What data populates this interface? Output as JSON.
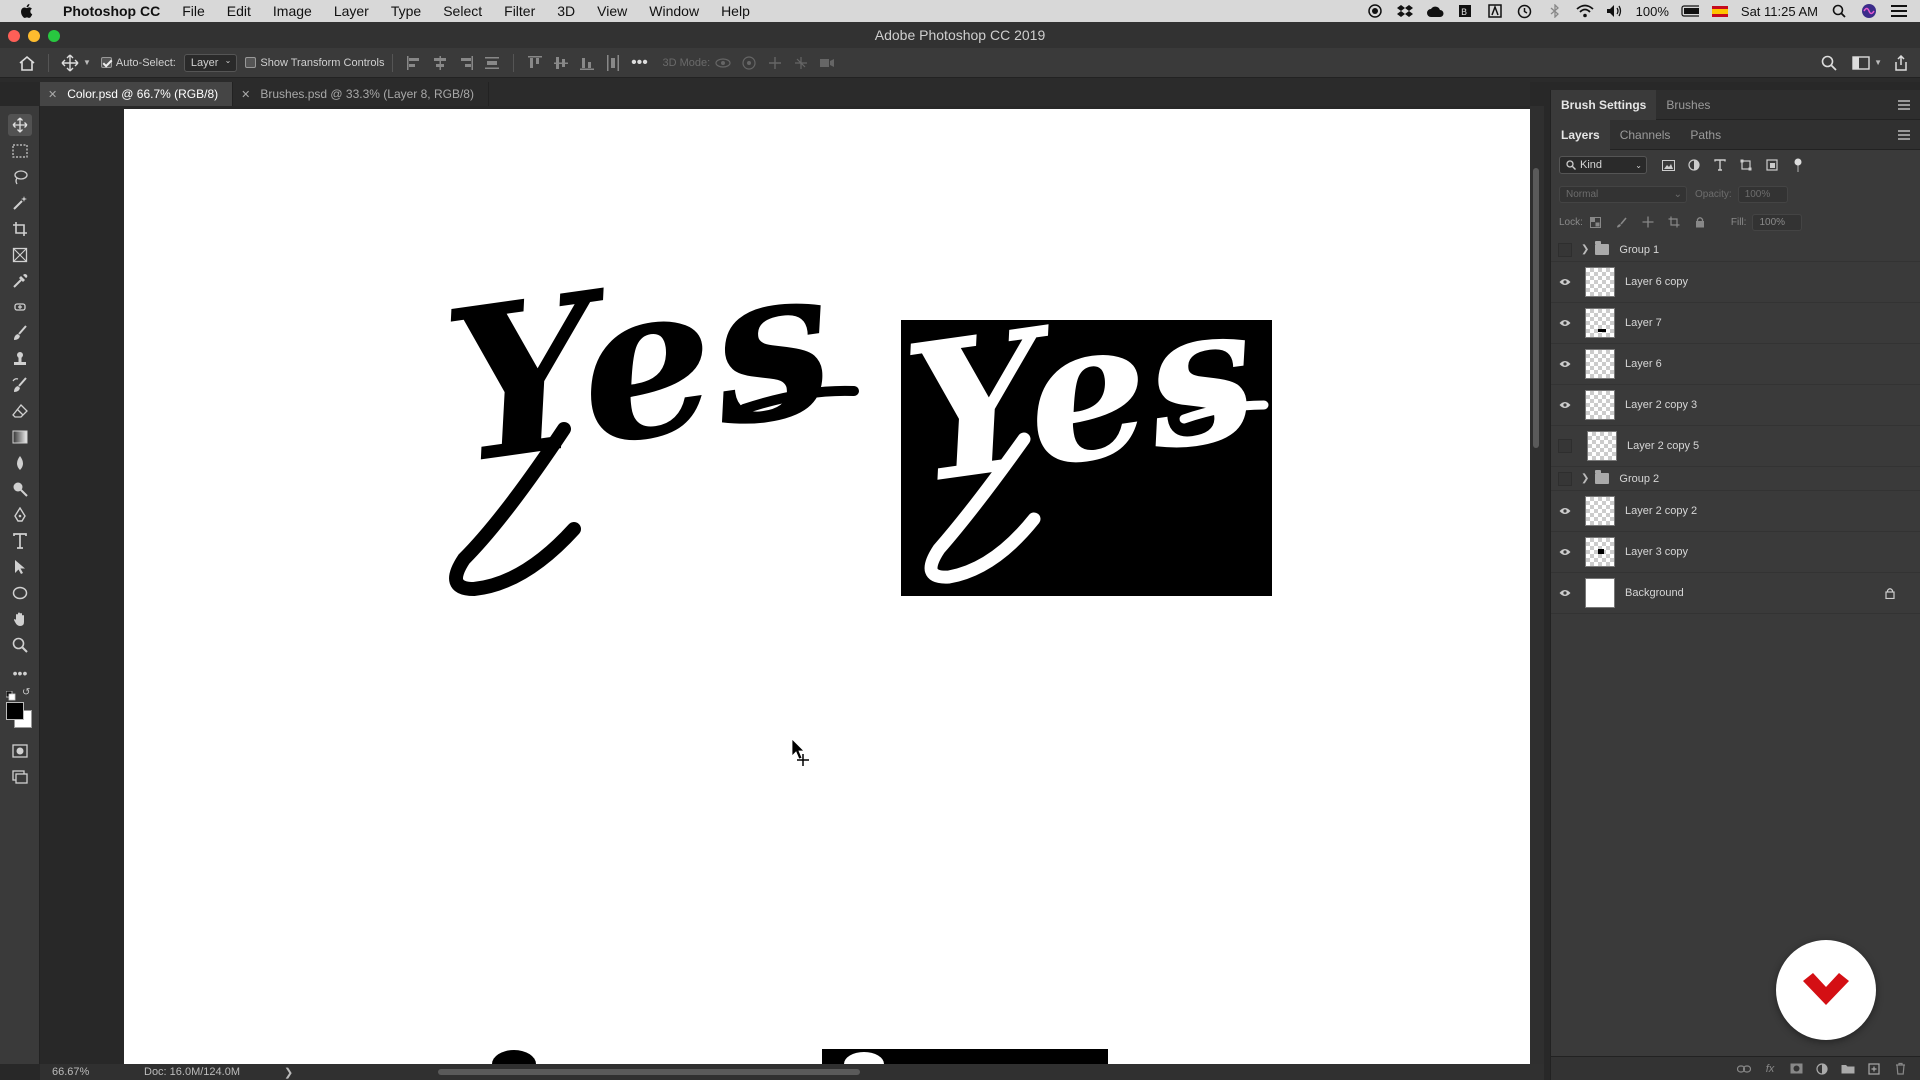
{
  "menubar": {
    "app_name": "Photoshop CC",
    "items": [
      "File",
      "Edit",
      "Image",
      "Layer",
      "Type",
      "Select",
      "Filter",
      "3D",
      "View",
      "Window",
      "Help"
    ],
    "battery": "100%",
    "clock": "Sat 11:25 AM"
  },
  "window": {
    "title": "Adobe Photoshop CC 2019"
  },
  "options": {
    "auto_select_label": "Auto-Select:",
    "auto_select_value": "Layer",
    "transform_label": "Show Transform Controls",
    "mode_3d_label": "3D Mode:"
  },
  "tabs": [
    {
      "label": "Color.psd @ 66.7% (RGB/8)",
      "active": true
    },
    {
      "label": "Brushes.psd @ 33.3% (Layer 8, RGB/8)",
      "active": false
    }
  ],
  "canvas": {
    "text_black": "Yes",
    "text_white": "Yes"
  },
  "status": {
    "zoom": "66.67%",
    "doc": "Doc: 16.0M/124.0M"
  },
  "panels": {
    "top_tabs": [
      "Brush Settings",
      "Brushes"
    ],
    "layer_tabs": [
      "Layers",
      "Channels",
      "Paths"
    ],
    "filter_kind": "Kind",
    "blend_mode": "Normal",
    "opacity_label": "Opacity:",
    "opacity_value": "100%",
    "lock_label": "Lock:",
    "fill_label": "Fill:",
    "fill_value": "100%"
  },
  "layers": [
    {
      "name": "Group 1",
      "type": "group",
      "visible": false
    },
    {
      "name": "Layer 6 copy",
      "type": "layer",
      "visible": true
    },
    {
      "name": "Layer 7",
      "type": "layer",
      "visible": true
    },
    {
      "name": "Layer 6",
      "type": "layer",
      "visible": true
    },
    {
      "name": "Layer 2 copy 3",
      "type": "layer",
      "visible": true
    },
    {
      "name": "Layer 2 copy 5",
      "type": "layer",
      "visible": false
    },
    {
      "name": "Group 2",
      "type": "group",
      "visible": false
    },
    {
      "name": "Layer 2 copy 2",
      "type": "layer",
      "visible": true
    },
    {
      "name": "Layer 3 copy",
      "type": "layer",
      "visible": true
    },
    {
      "name": "Background",
      "type": "background",
      "visible": true,
      "locked": true
    }
  ],
  "colors": {
    "badge_red": "#d40f14",
    "canvas_bg": "#ffffff",
    "panel_bg": "#3a3a3a"
  }
}
